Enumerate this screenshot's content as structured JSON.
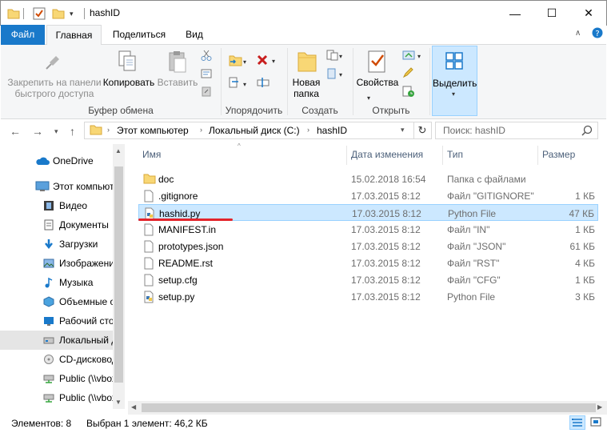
{
  "window": {
    "title": "hashID",
    "controls": {
      "minimize": "—",
      "maximize": "☐",
      "close": "✕"
    }
  },
  "ribbon_tabs": [
    {
      "label": "Файл"
    },
    {
      "label": "Главная"
    },
    {
      "label": "Поделиться"
    },
    {
      "label": "Вид"
    }
  ],
  "ribbon": {
    "pin_label": "Закрепить на панели быстрого доступа",
    "pin_line1": "Закрепить на панели",
    "pin_line2": "быстрого доступа",
    "copy": "Копировать",
    "paste": "Вставить",
    "clipboard_group": "Буфер обмена",
    "organize_group": "Упорядочить",
    "new_folder_line1": "Новая",
    "new_folder_line2": "папка",
    "create_group": "Создать",
    "properties": "Свойства",
    "open_group": "Открыть",
    "select": "Выделить"
  },
  "address": {
    "crumbs": [
      "Этот компьютер",
      "Локальный диск (C:)",
      "hashID"
    ],
    "search_placeholder": "Поиск: hashID"
  },
  "nav_items": [
    {
      "label": "OneDrive",
      "icon": "cloud-icon"
    },
    {
      "label": "Этот компьютер",
      "icon": "computer-icon"
    },
    {
      "label": "Видео",
      "icon": "video-icon"
    },
    {
      "label": "Документы",
      "icon": "documents-icon"
    },
    {
      "label": "Загрузки",
      "icon": "downloads-icon"
    },
    {
      "label": "Изображения",
      "icon": "pictures-icon"
    },
    {
      "label": "Музыка",
      "icon": "music-icon"
    },
    {
      "label": "Объемные объекты",
      "icon": "3d-objects-icon"
    },
    {
      "label": "Рабочий стол",
      "icon": "desktop-icon"
    },
    {
      "label": "Локальный диск (C:)",
      "icon": "drive-icon",
      "selected": true
    },
    {
      "label": "CD-дисковод",
      "icon": "cd-drive-icon"
    },
    {
      "label": "Public (\\\\vbox",
      "icon": "network-drive-icon"
    },
    {
      "label": "Public (\\\\vbox",
      "icon": "network-drive-icon"
    }
  ],
  "columns": {
    "name": "Имя",
    "date": "Дата изменения",
    "type": "Тип",
    "size": "Размер"
  },
  "files": [
    {
      "name": "doc",
      "date": "15.02.2018 16:54",
      "type": "Папка с файлами",
      "size": "",
      "icon": "folder-icon"
    },
    {
      "name": ".gitignore",
      "date": "17.03.2015 8:12",
      "type": "Файл \"GITIGNORE\"",
      "size": "1 КБ",
      "icon": "file-icon"
    },
    {
      "name": "hashid.py",
      "date": "17.03.2015 8:12",
      "type": "Python File",
      "size": "47 КБ",
      "icon": "python-file-icon",
      "selected": true
    },
    {
      "name": "MANIFEST.in",
      "date": "17.03.2015 8:12",
      "type": "Файл \"IN\"",
      "size": "1 КБ",
      "icon": "file-icon"
    },
    {
      "name": "prototypes.json",
      "date": "17.03.2015 8:12",
      "type": "Файл \"JSON\"",
      "size": "61 КБ",
      "icon": "file-icon"
    },
    {
      "name": "README.rst",
      "date": "17.03.2015 8:12",
      "type": "Файл \"RST\"",
      "size": "4 КБ",
      "icon": "file-icon"
    },
    {
      "name": "setup.cfg",
      "date": "17.03.2015 8:12",
      "type": "Файл \"CFG\"",
      "size": "1 КБ",
      "icon": "file-icon"
    },
    {
      "name": "setup.py",
      "date": "17.03.2015 8:12",
      "type": "Python File",
      "size": "3 КБ",
      "icon": "python-file-icon"
    }
  ],
  "status": {
    "items": "Элементов: 8",
    "selected": "Выбран 1 элемент: 46,2 КБ"
  },
  "colors": {
    "accent": "#1979ca",
    "selection": "#cce8ff",
    "annotation": "#e3242b"
  }
}
